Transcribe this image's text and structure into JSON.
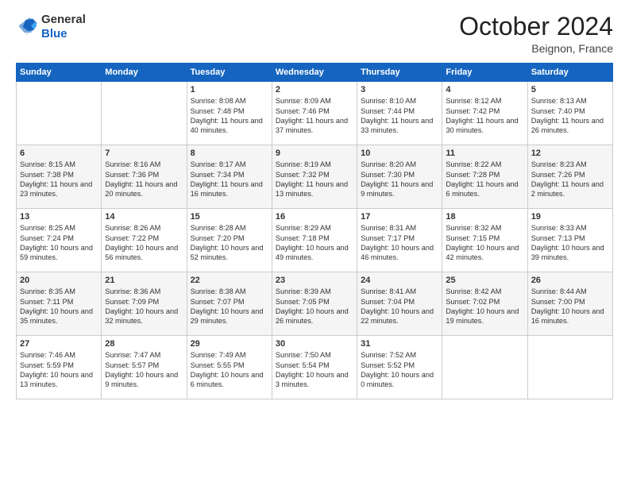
{
  "header": {
    "logo": {
      "general": "General",
      "blue": "Blue"
    },
    "title": "October 2024",
    "location": "Beignon, France"
  },
  "days_of_week": [
    "Sunday",
    "Monday",
    "Tuesday",
    "Wednesday",
    "Thursday",
    "Friday",
    "Saturday"
  ],
  "weeks": [
    [
      {
        "day": "",
        "info": ""
      },
      {
        "day": "",
        "info": ""
      },
      {
        "day": "1",
        "info": "Sunrise: 8:08 AM\nSunset: 7:48 PM\nDaylight: 11 hours and 40 minutes."
      },
      {
        "day": "2",
        "info": "Sunrise: 8:09 AM\nSunset: 7:46 PM\nDaylight: 11 hours and 37 minutes."
      },
      {
        "day": "3",
        "info": "Sunrise: 8:10 AM\nSunset: 7:44 PM\nDaylight: 11 hours and 33 minutes."
      },
      {
        "day": "4",
        "info": "Sunrise: 8:12 AM\nSunset: 7:42 PM\nDaylight: 11 hours and 30 minutes."
      },
      {
        "day": "5",
        "info": "Sunrise: 8:13 AM\nSunset: 7:40 PM\nDaylight: 11 hours and 26 minutes."
      }
    ],
    [
      {
        "day": "6",
        "info": "Sunrise: 8:15 AM\nSunset: 7:38 PM\nDaylight: 11 hours and 23 minutes."
      },
      {
        "day": "7",
        "info": "Sunrise: 8:16 AM\nSunset: 7:36 PM\nDaylight: 11 hours and 20 minutes."
      },
      {
        "day": "8",
        "info": "Sunrise: 8:17 AM\nSunset: 7:34 PM\nDaylight: 11 hours and 16 minutes."
      },
      {
        "day": "9",
        "info": "Sunrise: 8:19 AM\nSunset: 7:32 PM\nDaylight: 11 hours and 13 minutes."
      },
      {
        "day": "10",
        "info": "Sunrise: 8:20 AM\nSunset: 7:30 PM\nDaylight: 11 hours and 9 minutes."
      },
      {
        "day": "11",
        "info": "Sunrise: 8:22 AM\nSunset: 7:28 PM\nDaylight: 11 hours and 6 minutes."
      },
      {
        "day": "12",
        "info": "Sunrise: 8:23 AM\nSunset: 7:26 PM\nDaylight: 11 hours and 2 minutes."
      }
    ],
    [
      {
        "day": "13",
        "info": "Sunrise: 8:25 AM\nSunset: 7:24 PM\nDaylight: 10 hours and 59 minutes."
      },
      {
        "day": "14",
        "info": "Sunrise: 8:26 AM\nSunset: 7:22 PM\nDaylight: 10 hours and 56 minutes."
      },
      {
        "day": "15",
        "info": "Sunrise: 8:28 AM\nSunset: 7:20 PM\nDaylight: 10 hours and 52 minutes."
      },
      {
        "day": "16",
        "info": "Sunrise: 8:29 AM\nSunset: 7:18 PM\nDaylight: 10 hours and 49 minutes."
      },
      {
        "day": "17",
        "info": "Sunrise: 8:31 AM\nSunset: 7:17 PM\nDaylight: 10 hours and 46 minutes."
      },
      {
        "day": "18",
        "info": "Sunrise: 8:32 AM\nSunset: 7:15 PM\nDaylight: 10 hours and 42 minutes."
      },
      {
        "day": "19",
        "info": "Sunrise: 8:33 AM\nSunset: 7:13 PM\nDaylight: 10 hours and 39 minutes."
      }
    ],
    [
      {
        "day": "20",
        "info": "Sunrise: 8:35 AM\nSunset: 7:11 PM\nDaylight: 10 hours and 35 minutes."
      },
      {
        "day": "21",
        "info": "Sunrise: 8:36 AM\nSunset: 7:09 PM\nDaylight: 10 hours and 32 minutes."
      },
      {
        "day": "22",
        "info": "Sunrise: 8:38 AM\nSunset: 7:07 PM\nDaylight: 10 hours and 29 minutes."
      },
      {
        "day": "23",
        "info": "Sunrise: 8:39 AM\nSunset: 7:05 PM\nDaylight: 10 hours and 26 minutes."
      },
      {
        "day": "24",
        "info": "Sunrise: 8:41 AM\nSunset: 7:04 PM\nDaylight: 10 hours and 22 minutes."
      },
      {
        "day": "25",
        "info": "Sunrise: 8:42 AM\nSunset: 7:02 PM\nDaylight: 10 hours and 19 minutes."
      },
      {
        "day": "26",
        "info": "Sunrise: 8:44 AM\nSunset: 7:00 PM\nDaylight: 10 hours and 16 minutes."
      }
    ],
    [
      {
        "day": "27",
        "info": "Sunrise: 7:46 AM\nSunset: 5:59 PM\nDaylight: 10 hours and 13 minutes."
      },
      {
        "day": "28",
        "info": "Sunrise: 7:47 AM\nSunset: 5:57 PM\nDaylight: 10 hours and 9 minutes."
      },
      {
        "day": "29",
        "info": "Sunrise: 7:49 AM\nSunset: 5:55 PM\nDaylight: 10 hours and 6 minutes."
      },
      {
        "day": "30",
        "info": "Sunrise: 7:50 AM\nSunset: 5:54 PM\nDaylight: 10 hours and 3 minutes."
      },
      {
        "day": "31",
        "info": "Sunrise: 7:52 AM\nSunset: 5:52 PM\nDaylight: 10 hours and 0 minutes."
      },
      {
        "day": "",
        "info": ""
      },
      {
        "day": "",
        "info": ""
      }
    ]
  ]
}
